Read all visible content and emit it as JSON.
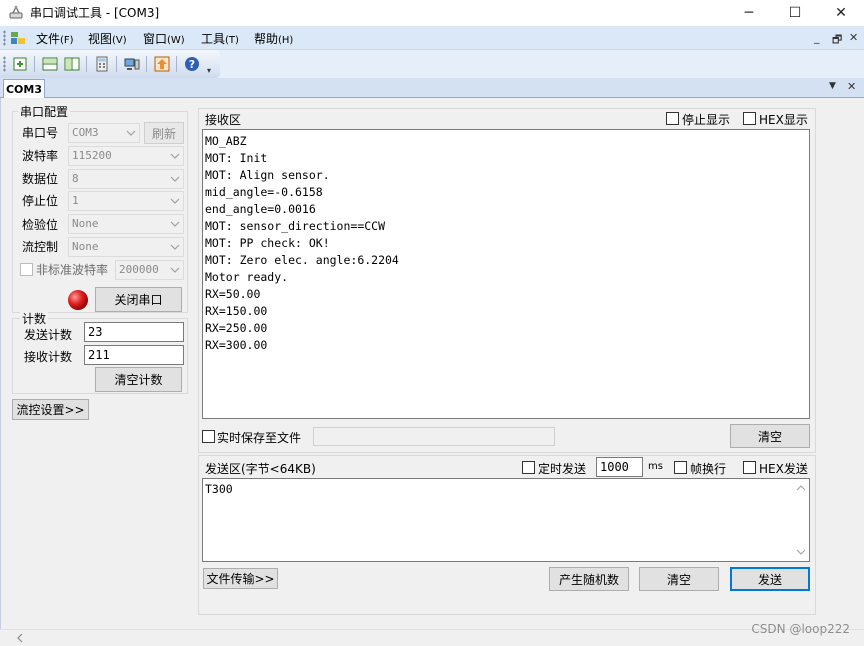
{
  "window": {
    "title": "串口调试工具 - [COM3]",
    "minimize_glyph": "─",
    "maximize_glyph": "☐",
    "close_glyph": "✕"
  },
  "menu": {
    "items": [
      {
        "label": "文件",
        "hotkey": "(F)"
      },
      {
        "label": "视图",
        "hotkey": "(V)"
      },
      {
        "label": "窗口",
        "hotkey": "(W)"
      },
      {
        "label": "工具",
        "hotkey": "(T)"
      },
      {
        "label": "帮助",
        "hotkey": "(H)"
      }
    ],
    "mdi_minimize": "_",
    "mdi_restore": "🗗",
    "mdi_close": "✕"
  },
  "tabs": {
    "active": "COM3",
    "dropdown_glyph": "▼",
    "close_glyph": "✕"
  },
  "serial_config": {
    "title": "串口配置",
    "port_label": "串口号",
    "port_value": "COM3",
    "refresh_label": "刷新",
    "baud_label": "波特率",
    "baud_value": "115200",
    "databits_label": "数据位",
    "databits_value": "8",
    "stopbits_label": "停止位",
    "stopbits_value": "1",
    "parity_label": "检验位",
    "parity_value": "None",
    "flow_label": "流控制",
    "flow_value": "None",
    "nonstd_label": "非标准波特率",
    "nonstd_value": "200000",
    "close_port_label": "关闭串口"
  },
  "counts": {
    "title": "计数",
    "send_label": "发送计数",
    "send_value": "23",
    "recv_label": "接收计数",
    "recv_value": "211",
    "clear_label": "清空计数"
  },
  "flow_settings_label": "流控设置>>",
  "receive": {
    "title": "接收区",
    "stop_display_label": "停止显示",
    "hex_display_label": "HEX显示",
    "lines": [
      "MO_ABZ",
      "MOT: Init",
      "MOT: Align sensor.",
      "mid_angle=-0.6158",
      "end_angle=0.0016",
      "MOT: sensor_direction==CCW",
      "MOT: PP check: OK!",
      "MOT: Zero elec. angle:6.2204",
      "Motor ready.",
      "RX=50.00",
      "RX=150.00",
      "RX=250.00",
      "RX=300.00"
    ],
    "save_to_file_label": "实时保存至文件",
    "clear_label": "清空"
  },
  "send": {
    "title": "发送区(字节<64KB)",
    "timed_send_label": "定时发送",
    "interval_value": "1000",
    "interval_unit": "ms",
    "newline_label": "帧换行",
    "hex_send_label": "HEX发送",
    "content": "T300",
    "file_transfer_label": "文件传输>>",
    "random_label": "产生随机数",
    "clear_label": "清空",
    "send_label": "发送"
  },
  "watermark": "CSDN @loop222",
  "colors": {
    "status_led": "#e02020",
    "menubar_bg": "#dbe8f8",
    "accent": "#0078d7"
  }
}
